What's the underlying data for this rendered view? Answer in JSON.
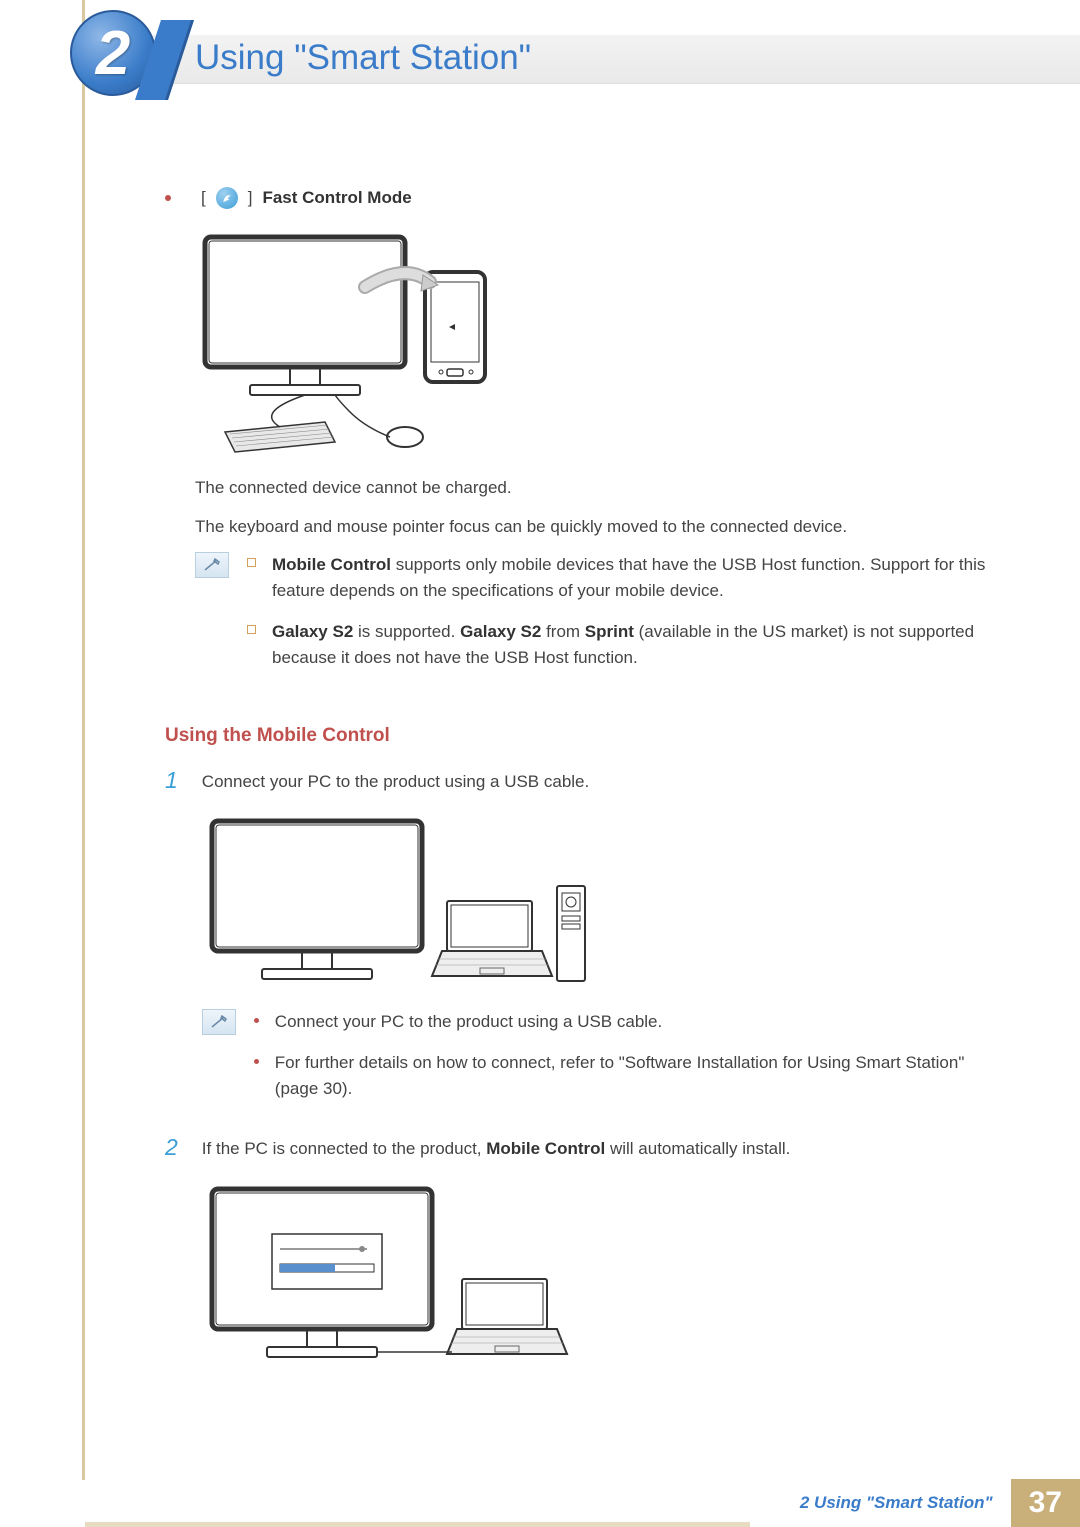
{
  "chapter": {
    "number": "2",
    "title": "Using \"Smart Station\""
  },
  "mode": {
    "label_prefix": "[",
    "label_suffix": "]",
    "name": "Fast Control Mode",
    "desc1": "The connected device cannot be charged.",
    "desc2": "The keyboard and mouse pointer focus can be quickly moved to the connected device."
  },
  "notes1": {
    "item1_bold": "Mobile Control",
    "item1_rest": " supports only mobile devices that have the USB Host function. Support for this feature depends on the specifications of your mobile device.",
    "item2_bold1": "Galaxy S2",
    "item2_mid1": " is supported. ",
    "item2_bold2": "Galaxy S2",
    "item2_mid2": " from ",
    "item2_bold3": "Sprint",
    "item2_rest": " (available in the US market) is not supported because it does not have the USB Host function."
  },
  "section": {
    "heading": "Using the Mobile Control"
  },
  "step1": {
    "num": "1",
    "text": "Connect your PC to the product using a USB cable.",
    "note_a": "Connect your PC to the product using a USB cable.",
    "note_b": "For further details on how to connect, refer to \"Software Installation for Using Smart Station\" (page 30)."
  },
  "step2": {
    "num": "2",
    "text_pre": "If the PC is connected to the product, ",
    "text_bold": "Mobile Control",
    "text_post": " will automatically install."
  },
  "footer": {
    "text": "2 Using \"Smart Station\"",
    "page": "37"
  }
}
